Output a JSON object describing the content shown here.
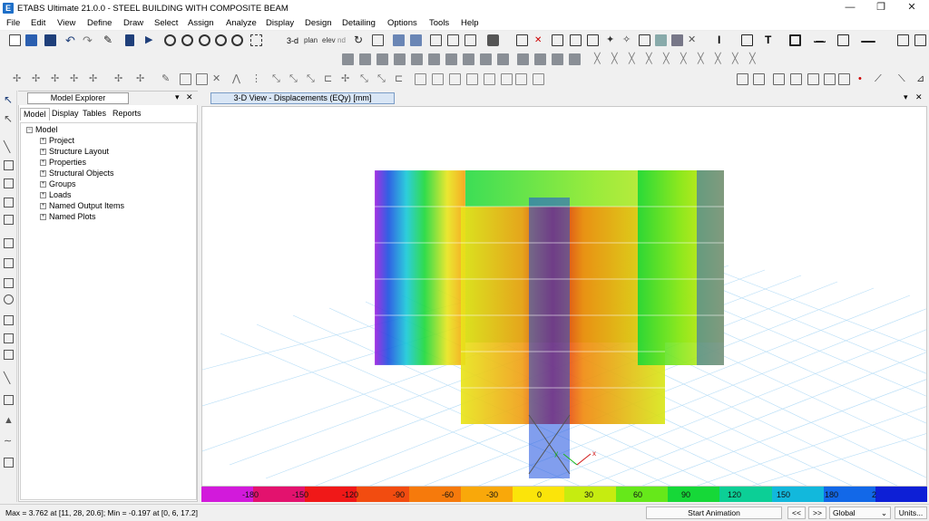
{
  "app": {
    "title": "ETABS Ultimate 21.0.0 - STEEL BUILDING WITH COMPOSITE BEAM",
    "icon_letter": "E"
  },
  "window_controls": {
    "minimize": "—",
    "maximize": "❐",
    "close": "✕"
  },
  "menu": [
    "File",
    "Edit",
    "View",
    "Define",
    "Draw",
    "Select",
    "Assign",
    "Analyze",
    "Display",
    "Design",
    "Detailing",
    "Options",
    "Tools",
    "Help"
  ],
  "toolbar": {
    "view_3d": "3-d",
    "plan": "plan",
    "elev": "elev",
    "nd": "nd"
  },
  "model_explorer": {
    "title": "Model Explorer",
    "pin": "▾",
    "close": "✕",
    "tabs": [
      "Model",
      "Display",
      "Tables",
      "Reports"
    ],
    "root": "Model",
    "items": [
      "Project",
      "Structure Layout",
      "Properties",
      "Structural Objects",
      "Groups",
      "Loads",
      "Named Output Items",
      "Named Plots"
    ]
  },
  "view": {
    "title": "3-D View  - Displacements (EQy)  [mm]",
    "pin": "▾",
    "close": "✕",
    "axis_x": "x",
    "axis_y": "y"
  },
  "legend": {
    "labels": [
      "-180",
      "-150",
      "-120",
      "-90",
      "-60",
      "-30",
      "0",
      "30",
      "60",
      "90",
      "120",
      "150",
      "180",
      "2"
    ],
    "colors": [
      "#d21adb",
      "#e3126e",
      "#f01818",
      "#f24c10",
      "#f67a0c",
      "#f9a80a",
      "#fbe40a",
      "#c6ec10",
      "#66e81a",
      "#16d838",
      "#0ccf96",
      "#12b8dc",
      "#1268e8",
      "#0d1fd6"
    ]
  },
  "status": {
    "text": "Max = 3.762 at [11, 28, 20.6]; Min = -0.197 at [0, 6, 17.2]",
    "start_animation": "Start Animation",
    "prev": "<<",
    "next": ">>",
    "coord_system": "Global",
    "units": "Units..."
  },
  "colors": {
    "accent": "#1e6fc8",
    "grid": "#a9d7f5",
    "frame_blue": "#1a4fe0"
  }
}
